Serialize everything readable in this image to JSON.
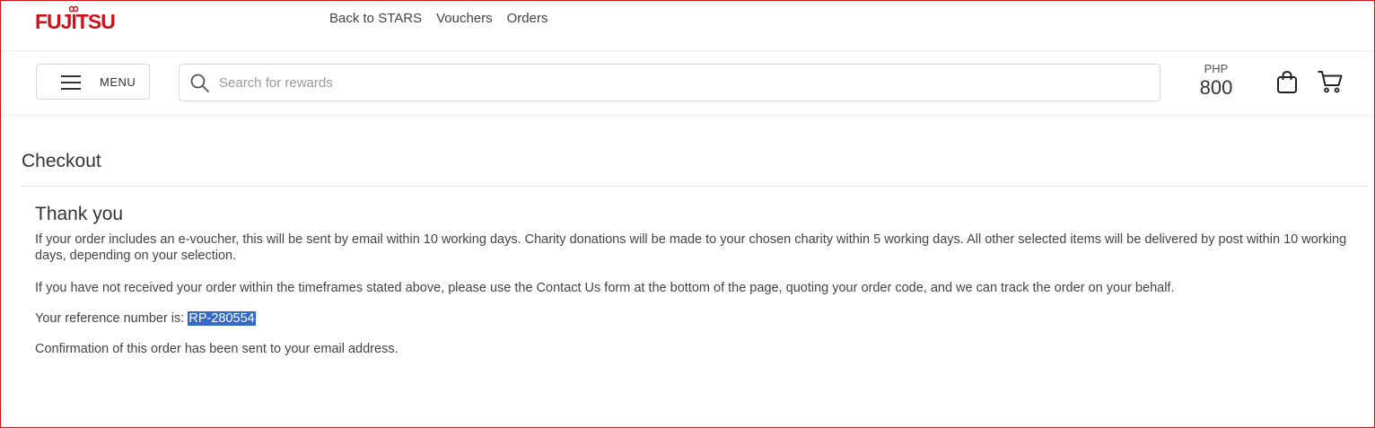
{
  "brand": {
    "logo_text": "FUJITSU",
    "color": "#d0101a"
  },
  "top_nav": {
    "links": [
      "Back to STARS",
      "Vouchers",
      "Orders"
    ]
  },
  "header": {
    "menu_label": "MENU",
    "search_placeholder": "Search for rewards",
    "search_value": "",
    "balance_currency": "PHP",
    "balance_amount": "800",
    "icons": [
      "hamburger-icon",
      "search-icon",
      "shopping-bag-icon",
      "cart-icon"
    ]
  },
  "page": {
    "title": "Checkout",
    "thank_you_heading": "Thank you",
    "paragraph_1": "If your order includes an e-voucher, this will be sent by email within 10 working days. Charity donations will be made to your chosen charity within 5 working days. All other selected items will be delivered by post within 10 working days, depending on your selection.",
    "paragraph_2": "If you have not received your order within the timeframes stated above, please use the Contact Us form at the bottom of the page, quoting your order code, and we can track the order on your behalf.",
    "reference_label": "Your reference number is: ",
    "reference_number": "RP-280554",
    "confirmation": "Confirmation of this order has been sent to your email address."
  },
  "colors": {
    "accent": "#d0101a",
    "selection_highlight": "#3368c8"
  }
}
